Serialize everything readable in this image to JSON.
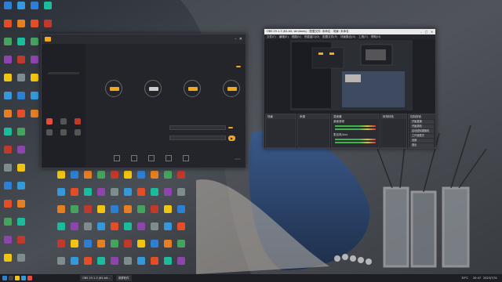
{
  "desktop": {
    "icons": [
      {
        "label": "",
        "color": "#2d7fd3"
      },
      {
        "label": "",
        "color": "#e44d26"
      },
      {
        "label": "",
        "color": "#46a35e"
      },
      {
        "label": "",
        "color": "#8e44ad"
      },
      {
        "label": "",
        "color": "#f1c40f"
      },
      {
        "label": "",
        "color": "#3498db"
      },
      {
        "label": "",
        "color": "#e67e22"
      },
      {
        "label": "",
        "color": "#1abc9c"
      },
      {
        "label": "",
        "color": "#c0392b"
      },
      {
        "label": "",
        "color": "#7f8c8d"
      }
    ]
  },
  "recorder": {
    "title": "",
    "top_button": "",
    "steps": [
      "",
      "",
      "",
      ""
    ],
    "field1_label": "",
    "field2_label": "",
    "confirm_btn": "",
    "footer_btn": ""
  },
  "obs": {
    "title": "OBS 29.1.3 (64-bit, windows) - 配置文件: 未命名 - 场景: 未命名",
    "menu": [
      "文件(F)",
      "编辑(E)",
      "视图(V)",
      "停靠窗口(D)",
      "配置文件(P)",
      "场景集合(S)",
      "工具(T)",
      "帮助(H)"
    ],
    "docks": {
      "scenes": "场景",
      "sources": "来源",
      "mixer": "混音器",
      "transitions": "转场特效",
      "controls": "控制按钮"
    },
    "mixer_rows": [
      "桌面音频",
      "麦克风/Aux"
    ],
    "controls": [
      "开始直播",
      "开始录制",
      "启动虚拟摄像机",
      "工作室模式",
      "设置",
      "退出"
    ]
  },
  "taskbar": {
    "items": [
      "OBS 29.1.3 (64-bit...",
      "录屏软件"
    ],
    "clock": "2023/7/31",
    "time": "20:47",
    "weather": "30°C"
  }
}
